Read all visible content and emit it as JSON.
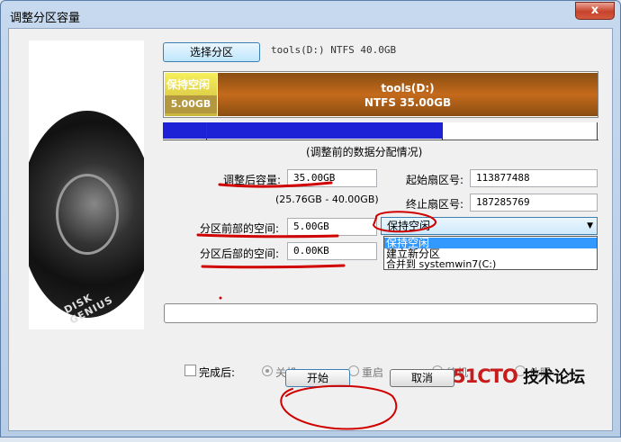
{
  "window": {
    "title": "调整分区容量",
    "close_glyph": "x"
  },
  "partition": {
    "select_label": "选择分区",
    "info": "tools(D:) NTFS 40.0GB",
    "free_label": "保持空闲",
    "free_size": "5.00GB",
    "vol_name": "tools(D:)",
    "vol_desc": "NTFS 35.00GB",
    "data_fill_fraction": 0.64,
    "caption": "(调整前的数据分配情况)"
  },
  "form": {
    "new_size_label": "调整后容量:",
    "new_size_value": "35.00GB",
    "size_range": "(25.76GB - 40.00GB)",
    "start_sector_label": "起始扇区号:",
    "start_sector_value": "113877488",
    "end_sector_label": "终止扇区号:",
    "end_sector_value": "187285769",
    "front_space_label": "分区前部的空间:",
    "front_space_value": "5.00GB",
    "back_space_label": "分区后部的空间:",
    "back_space_value": "0.00KB",
    "front_action": {
      "selected": "保持空闲",
      "options": [
        "保持空闲",
        "建立新分区",
        "合并到 systemwin7(C:)"
      ]
    }
  },
  "completion": {
    "label": "完成后:",
    "options": [
      "关机",
      "重启",
      "待机",
      "休眠"
    ]
  },
  "buttons": {
    "start": "开始",
    "cancel": "取消"
  },
  "watermark": {
    "part1": "51CTO",
    "part2": "技术论坛"
  },
  "side_logo": "DISK GENIUS",
  "colors": {
    "accent": "#3c7fb1",
    "data_fill": "#1e22d6",
    "annotation": "#d00000"
  }
}
